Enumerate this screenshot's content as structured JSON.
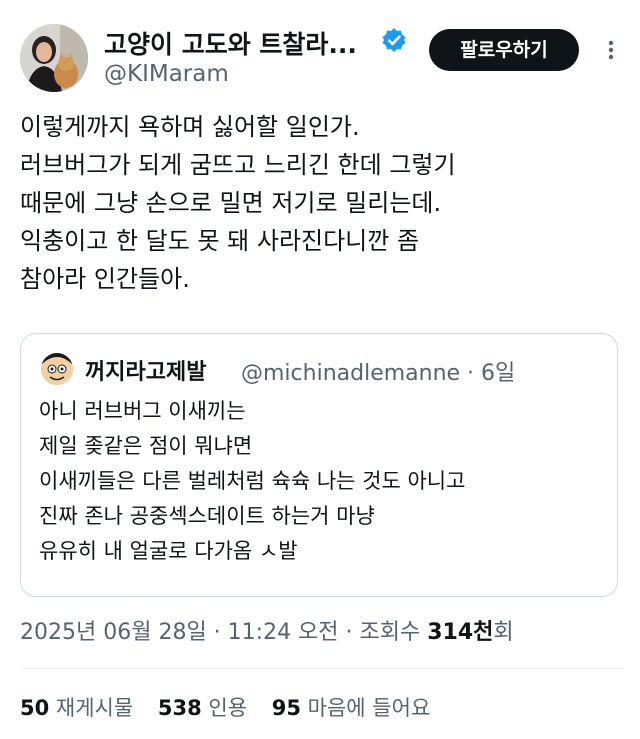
{
  "author": {
    "display_name": "고양이 고도와 트찰라...",
    "handle": "@KIMaram",
    "verified_icon": "verified-badge-icon",
    "follow_label": "팔로우하기"
  },
  "tweet": {
    "lines": [
      "이렇게까지 욕하며 싫어할 일인가.",
      "러브버그가 되게 굼뜨고 느리긴 한데 그렇기",
      "때문에 그냥 손으로 밀면 저기로 밀리는데.",
      "익충이고 한 달도 못 돼 사라진다니깐 좀",
      "참아라 인간들아."
    ]
  },
  "quoted": {
    "name": "꺼지라고제발",
    "handle_time": "@michinadlemanne · 6일",
    "lines": [
      "아니 러브버그 이새끼는",
      "제일 좆같은 점이 뭐냐면",
      "이새끼들은 다른 벌레처럼 슉슉 나는 것도 아니고",
      "진짜 존나 공중섹스데이트 하는거 마냥",
      "유유히 내 얼굴로 다가옴 ㅅ발"
    ]
  },
  "meta": {
    "timestamp": "2025년 06월 28일 · 11:24 오전 · 조회수 ",
    "views": "314천",
    "views_suffix": "회"
  },
  "stats": {
    "retweets_count": "50",
    "retweets_label": "재게시물",
    "quotes_count": "538",
    "quotes_label": "인용",
    "likes_count": "95",
    "likes_label": "마음에 들어요"
  },
  "colors": {
    "text": "#0f1419",
    "secondary": "#536471",
    "verified": "#1d9bf0",
    "border": "#cfd9de"
  }
}
